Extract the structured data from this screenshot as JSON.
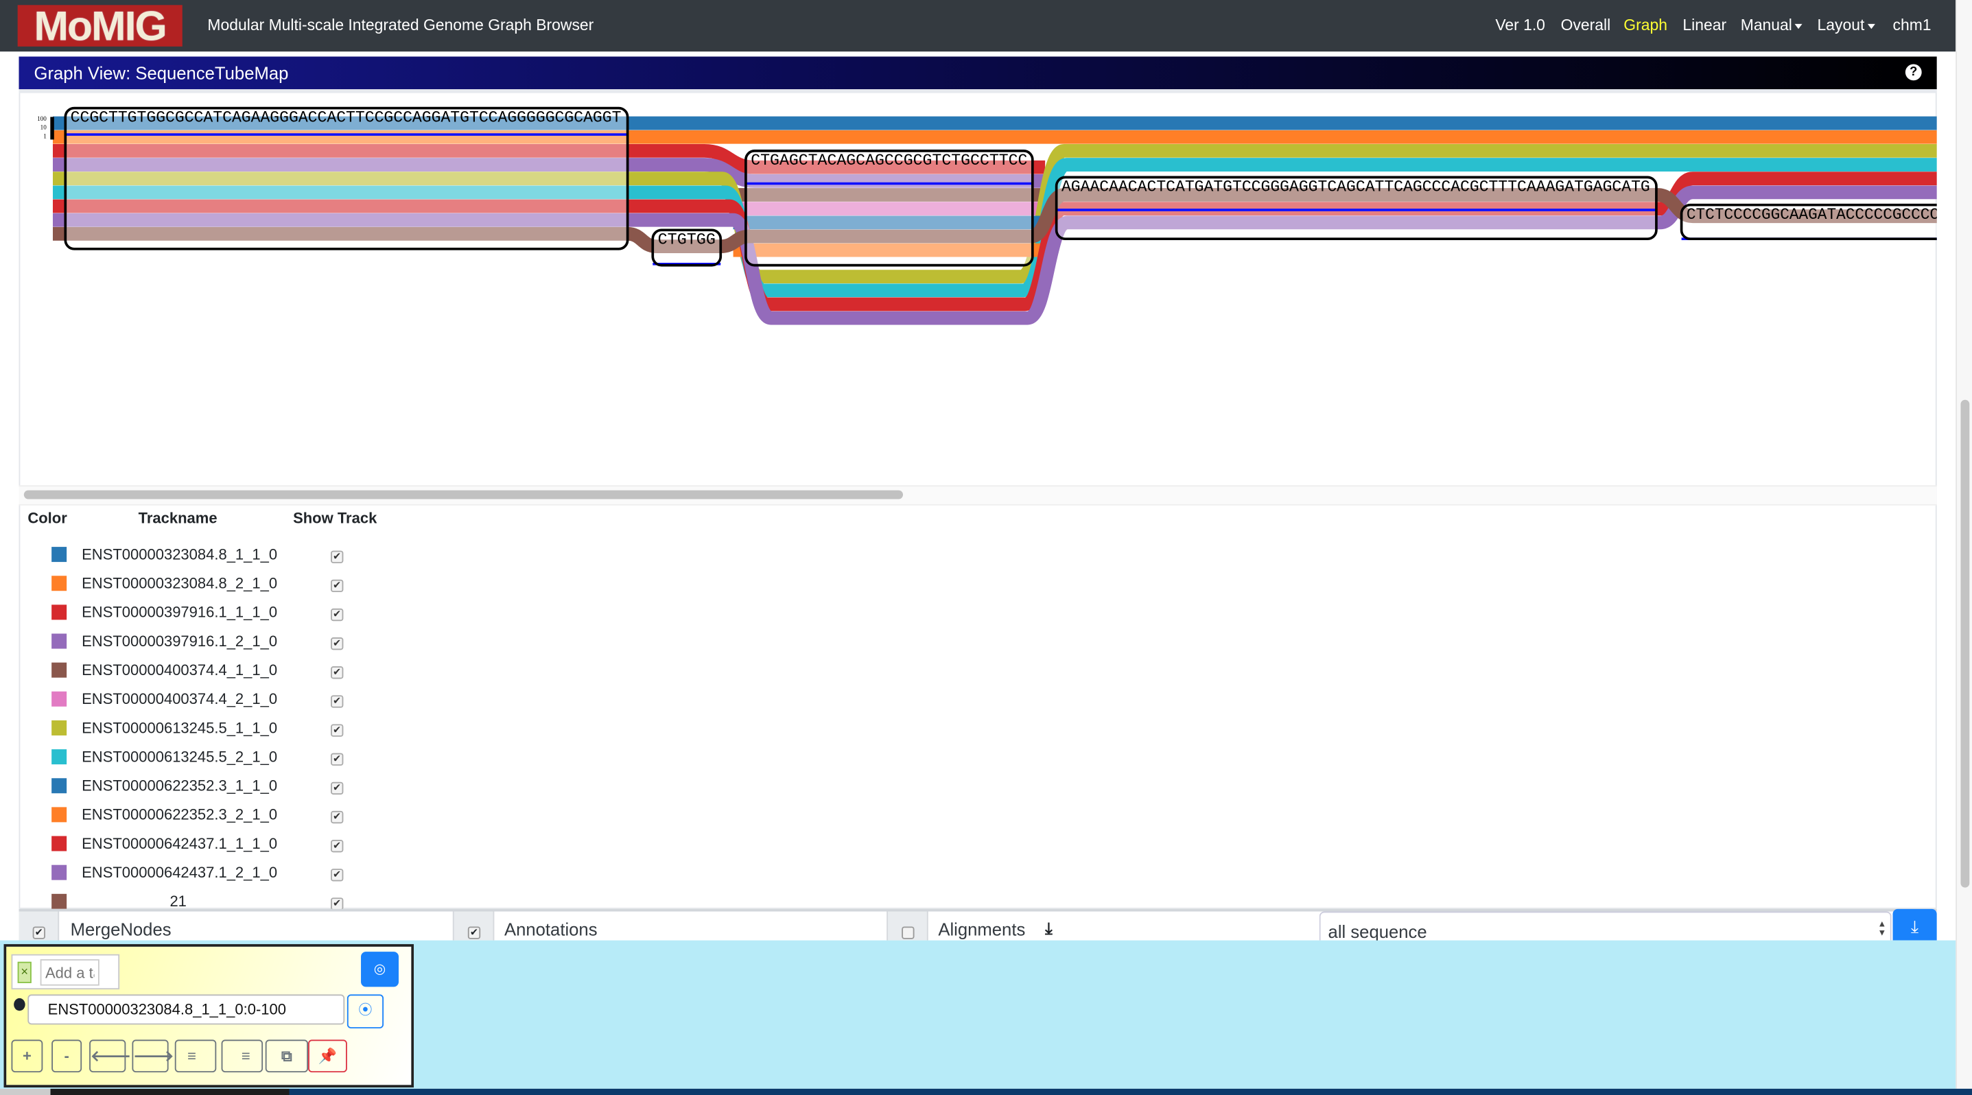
{
  "navbar": {
    "logo": "MoMIG",
    "title": "Modular Multi-scale Integrated Genome Graph Browser",
    "items": [
      {
        "label": "Ver 1.0",
        "active": false,
        "dropdown": false
      },
      {
        "label": "Overall",
        "active": false,
        "dropdown": false
      },
      {
        "label": "Graph",
        "active": true,
        "dropdown": false
      },
      {
        "label": "Linear",
        "active": false,
        "dropdown": false
      },
      {
        "label": "Manual",
        "active": false,
        "dropdown": true
      },
      {
        "label": "Layout",
        "active": false,
        "dropdown": true
      },
      {
        "label": "chm1",
        "active": false,
        "dropdown": false
      }
    ],
    "active_color": "#ffff33"
  },
  "panel": {
    "title": "Graph View: SequenceTubeMap",
    "help_icon": "question-circle-icon"
  },
  "graph": {
    "scale_labels": [
      "100",
      "10",
      "1"
    ],
    "nodes": [
      {
        "sequence": "CCGCTTGTGGCGCCATCAGAAGGGACCACTTCCGCCAGGATGTCCAGGGGGCGCAGGT"
      },
      {
        "sequence": "CTGTGG"
      },
      {
        "sequence": "CTGAGCTACAGCAGCCGCGTCTGCCTTCC"
      },
      {
        "sequence": "AGAACAACACTCATGATGTCCGGGAGGTCAGCATTCAGCCCACGCTTTCAAAGATGAGCATG"
      },
      {
        "sequence": "CTCTCCCCGGCAAGATACCCCCGCCCC"
      }
    ],
    "read_color": "#1010ff"
  },
  "legend": {
    "headers": {
      "color": "Color",
      "trackname": "Trackname",
      "show": "Show Track"
    },
    "tracks": [
      {
        "name": "ENST00000323084.8_1_1_0",
        "color": "#2878b4",
        "show": true
      },
      {
        "name": "ENST00000323084.8_2_1_0",
        "color": "#ff7f27",
        "show": true
      },
      {
        "name": "ENST00000397916.1_1_1_0",
        "color": "#d62a2e",
        "show": true
      },
      {
        "name": "ENST00000397916.1_2_1_0",
        "color": "#946bbb",
        "show": true
      },
      {
        "name": "ENST00000400374.4_1_1_0",
        "color": "#8a574c",
        "show": true
      },
      {
        "name": "ENST00000400374.4_2_1_0",
        "color": "#e27bc3",
        "show": true
      },
      {
        "name": "ENST00000613245.5_1_1_0",
        "color": "#bdbd33",
        "show": true
      },
      {
        "name": "ENST00000613245.5_2_1_0",
        "color": "#29bfcf",
        "show": true
      },
      {
        "name": "ENST00000622352.3_1_1_0",
        "color": "#2878b4",
        "show": true
      },
      {
        "name": "ENST00000622352.3_2_1_0",
        "color": "#ff7f27",
        "show": true
      },
      {
        "name": "ENST00000642437.1_1_1_0",
        "color": "#d62a2e",
        "show": true
      },
      {
        "name": "ENST00000642437.1_2_1_0",
        "color": "#946bbb",
        "show": true
      },
      {
        "name": "21",
        "color": "#8a574c",
        "show": true
      }
    ]
  },
  "options": {
    "merge_nodes": {
      "label": "MergeNodes",
      "checked": true
    },
    "annotations": {
      "label": "Annotations",
      "checked": true
    },
    "alignments": {
      "label": "Alignments",
      "checked": false,
      "icon": "download-icon"
    },
    "sequence_select": "all sequence",
    "download_icon": "download-icon"
  },
  "float_panel": {
    "tag_placeholder": "Add a tag",
    "tag_remove": "×",
    "region": "ENST00000323084.8_1_1_0:0-100",
    "buttons": [
      {
        "label": "+",
        "name": "zoom-in"
      },
      {
        "label": "-",
        "name": "zoom-out"
      },
      {
        "label": "🡐",
        "name": "move-left"
      },
      {
        "label": "🡒",
        "name": "move-right"
      },
      {
        "label": "≡",
        "name": "align-left"
      },
      {
        "label": "≡",
        "name": "align-right"
      },
      {
        "label": "⧉",
        "name": "copy"
      },
      {
        "label": "📌",
        "name": "pin"
      }
    ]
  }
}
